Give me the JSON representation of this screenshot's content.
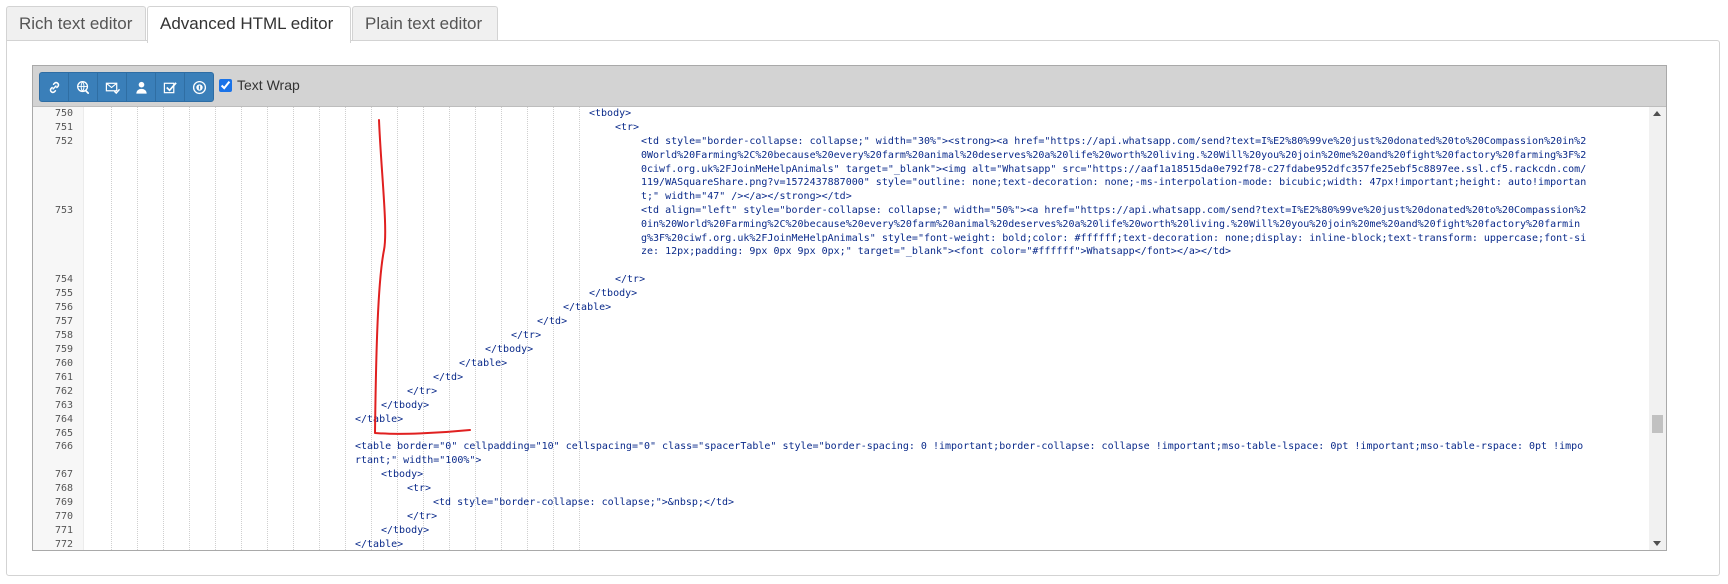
{
  "tabs": [
    {
      "label": "Rich text editor"
    },
    {
      "label": "Advanced HTML editor"
    },
    {
      "label": "Plain text editor"
    }
  ],
  "toolbar": {
    "icons": [
      "link-icon",
      "globe-link-icon",
      "email-check-icon",
      "user-icon",
      "checkmark-icon",
      "info-circle-icon"
    ],
    "text_wrap_label": "Text Wrap",
    "text_wrap_checked": true
  },
  "code_lines": [
    {
      "num": "750",
      "text": "<tbody>"
    },
    {
      "num": "751",
      "text": "<tr>"
    },
    {
      "num": "752",
      "text": "<td style=\"border-collapse: collapse;\" width=\"30%\"><strong><a href=\"https://api.whatsapp.com/send?text=I%E2%80%99ve%20just%20donated%20to%20Compassion%20in%20World%20Farming%2C%20because%20every%20farm%20animal%20deserves%20a%20life%20worth%20living.%20Will%20you%20join%20me%20and%20fight%20factory%20farming%3F%20ciwf.org.uk%2FJoinMeHelpAnimals\" target=\"_blank\"><img alt=\"Whatsapp\" src=\"https://aaf1a18515da0e792f78-c27fdabe952dfc357fe25ebf5c8897ee.ssl.cf5.rackcdn.com/119/WASquareShare.png?v=1572437887000\" style=\"outline: none;text-decoration: none;-ms-interpolation-mode: bicubic;width: 47px!important;height: auto!important;\" width=\"47\" /></a></strong></td>"
    },
    {
      "num": "753",
      "text": "<td align=\"left\" style=\"border-collapse: collapse;\" width=\"50%\"><a href=\"https://api.whatsapp.com/send?text=I%E2%80%99ve%20just%20donated%20to%20Compassion%20in%20World%20Farming%2C%20because%20every%20farm%20animal%20deserves%20a%20life%20worth%20living.%20Will%20you%20join%20me%20and%20fight%20factory%20farming%3F%20ciwf.org.uk%2FJoinMeHelpAnimals\" style=\"font-weight: bold;color: #ffffff;text-decoration: none;display: inline-block;text-transform: uppercase;font-size: 12px;padding: 9px 0px 9px 0px;\" target=\"_blank\"><font color=\"#ffffff\">Whatsapp</font></a></td>"
    },
    {
      "num": "754",
      "text": "</tr>"
    },
    {
      "num": "755",
      "text": "</tbody>"
    },
    {
      "num": "756",
      "text": "</table>"
    },
    {
      "num": "757",
      "text": "</td>"
    },
    {
      "num": "758",
      "text": "</tr>"
    },
    {
      "num": "759",
      "text": "</tbody>"
    },
    {
      "num": "760",
      "text": "</table>"
    },
    {
      "num": "761",
      "text": "</td>"
    },
    {
      "num": "762",
      "text": "</tr>"
    },
    {
      "num": "763",
      "text": "</tbody>"
    },
    {
      "num": "764",
      "text": "</table>"
    },
    {
      "num": "765",
      "text": ""
    },
    {
      "num": "766",
      "text": "<table border=\"0\" cellpadding=\"10\" cellspacing=\"0\" class=\"spacerTable\" style=\"border-spacing: 0 !important;border-collapse: collapse !important;mso-table-lspace: 0pt !important;mso-table-rspace: 0pt !important;\" width=\"100%\">"
    },
    {
      "num": "767",
      "text": "<tbody>"
    },
    {
      "num": "768",
      "text": "<tr>"
    },
    {
      "num": "769",
      "text": "<td style=\"border-collapse: collapse;\">&nbsp;</td>"
    },
    {
      "num": "770",
      "text": "</tr>"
    },
    {
      "num": "771",
      "text": "</tbody>"
    },
    {
      "num": "772",
      "text": "</table>"
    }
  ],
  "annotation_color": "#e02020"
}
